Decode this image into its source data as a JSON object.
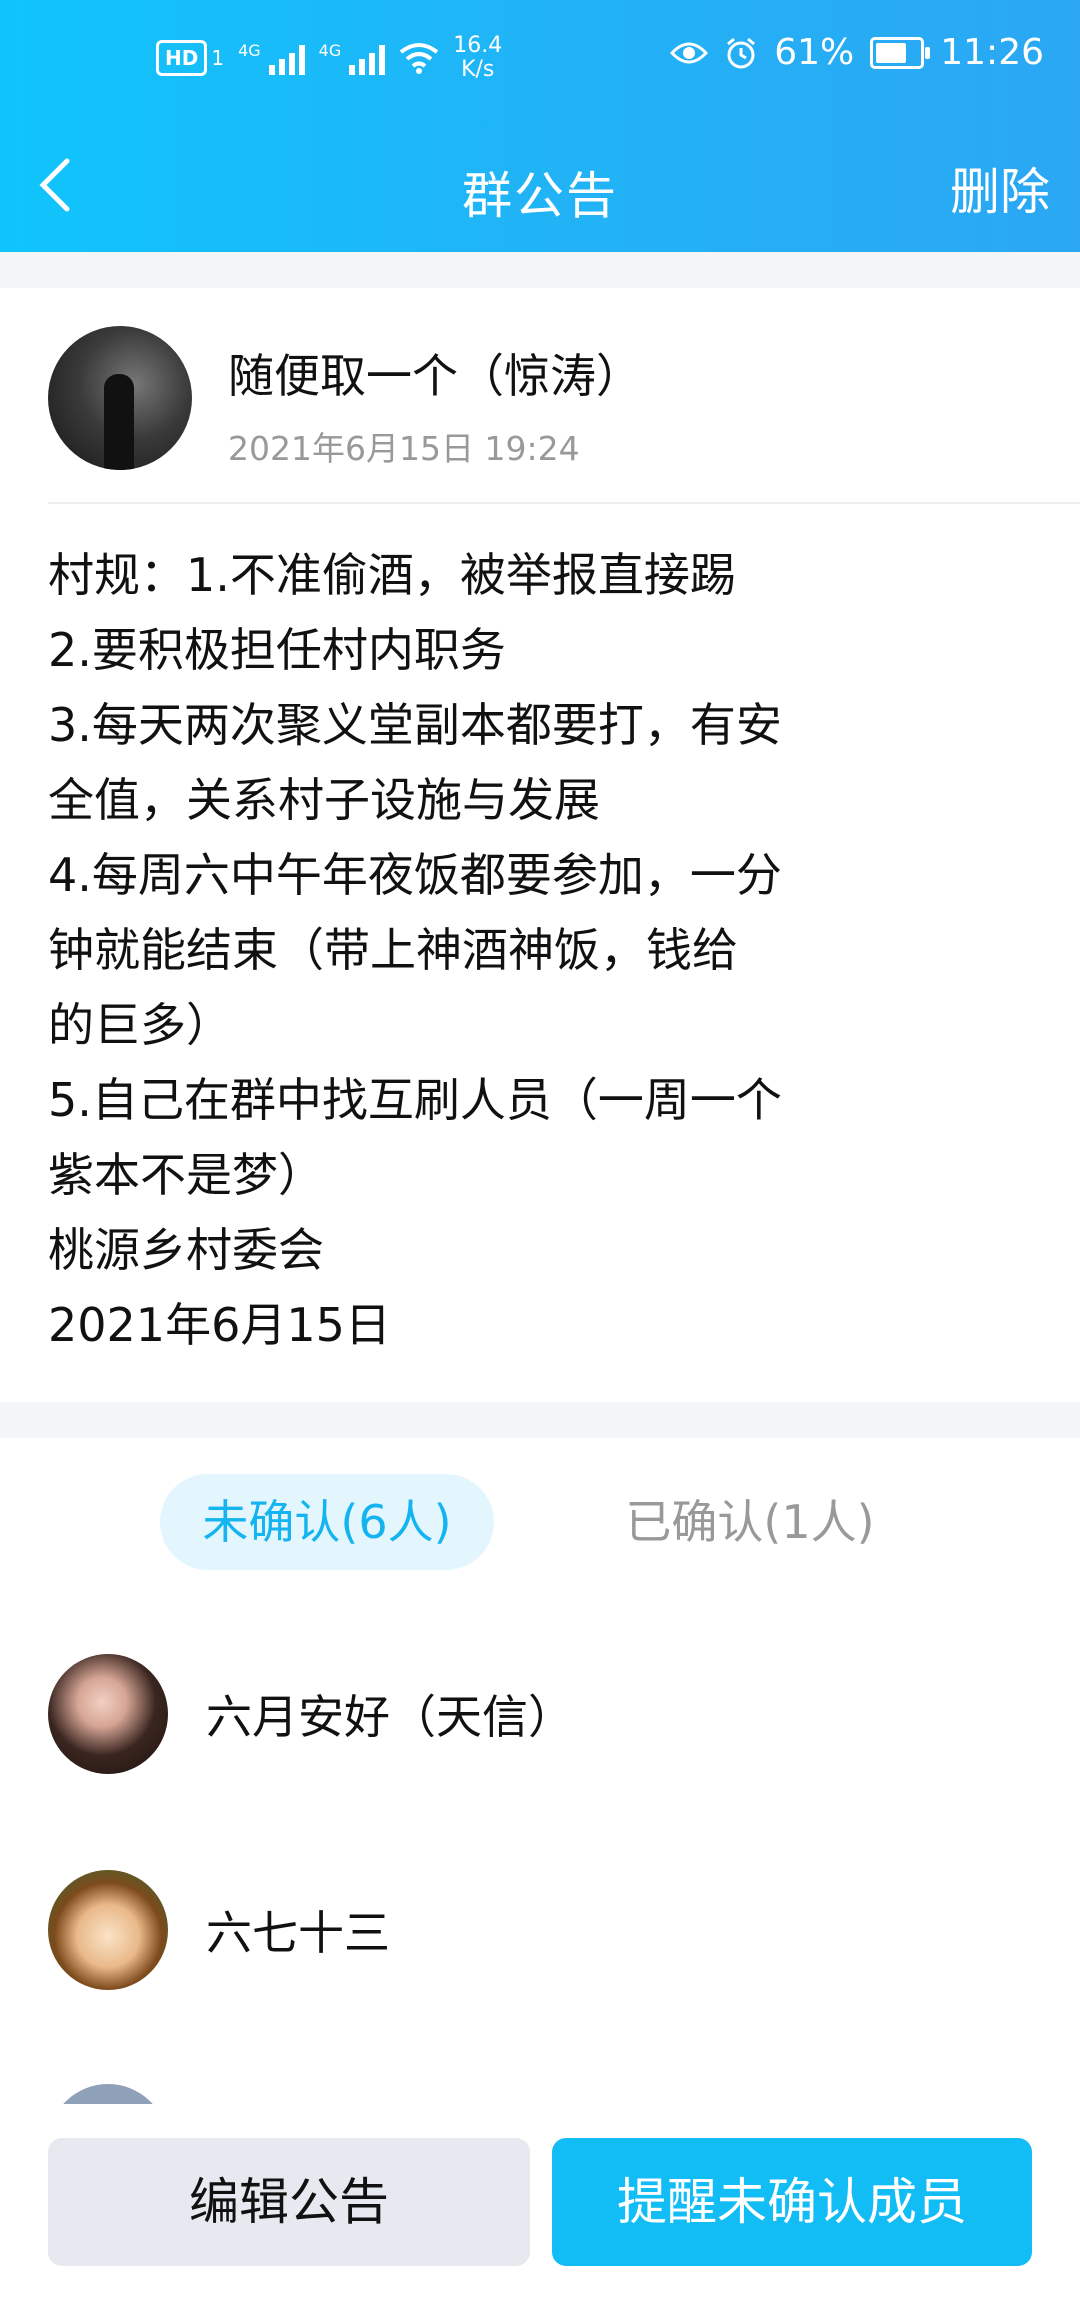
{
  "status_bar": {
    "hd": "HD",
    "sim_index": "1",
    "network1": "4G",
    "network2": "4G",
    "speed_value": "16.4",
    "speed_unit": "K/s",
    "battery": "61%",
    "battery_level": 0.61,
    "time": "11:26"
  },
  "nav": {
    "title": "群公告",
    "delete_label": "删除"
  },
  "announcement": {
    "author": "随便取一个（惊涛）",
    "timestamp": "2021年6月15日 19:24",
    "lines": [
      "村规：1.不准偷酒，被举报直接踢",
      "2.要积极担任村内职务",
      "3.每天两次聚义堂副本都要打，有安",
      "全值，关系村子设施与发展",
      "4.每周六中午年夜饭都要参加，一分",
      "钟就能结束（带上神酒神饭，钱给",
      "的巨多）",
      "5.自己在群中找互刷人员（一周一个",
      "紫本不是梦）",
      "桃源乡村委会",
      "2021年6月15日"
    ]
  },
  "tabs": {
    "unconfirmed": "未确认(6人)",
    "confirmed": "已确认(1人)"
  },
  "members": [
    {
      "name": "六月安好（天信）"
    },
    {
      "name": "六七十三"
    }
  ],
  "actions": {
    "edit_label": "编辑公告",
    "remind_label": "提醒未确认成员"
  }
}
